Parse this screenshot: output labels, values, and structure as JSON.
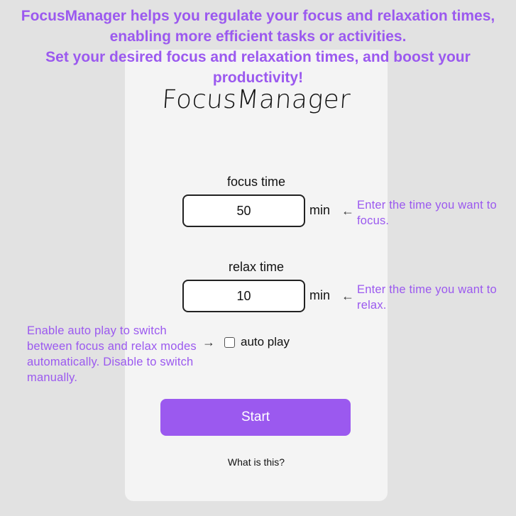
{
  "intro": {
    "line1": "FocusManager helps you regulate your focus and relaxation times, enabling more efficient tasks or activities.",
    "line2": "Set your desired focus and relaxation times, and boost your productivity!"
  },
  "app": {
    "logo": "FocusManager"
  },
  "focus": {
    "label": "focus time",
    "value": "50",
    "unit": "min",
    "arrow": "←",
    "hint": "Enter the time you want to focus."
  },
  "relax": {
    "label": "relax time",
    "value": "10",
    "unit": "min",
    "arrow": "←",
    "hint": "Enter the time you want to relax."
  },
  "auto_play": {
    "label": "auto play",
    "checked": false,
    "arrow": "→",
    "hint": "Enable auto play to switch between focus and relax modes automatically. Disable to switch manually."
  },
  "actions": {
    "start_label": "Start",
    "help_link": "What is this?"
  },
  "colors": {
    "accent": "#9b59ef",
    "page_background": "#e2e2e2",
    "card_background": "#f4f4f4"
  }
}
